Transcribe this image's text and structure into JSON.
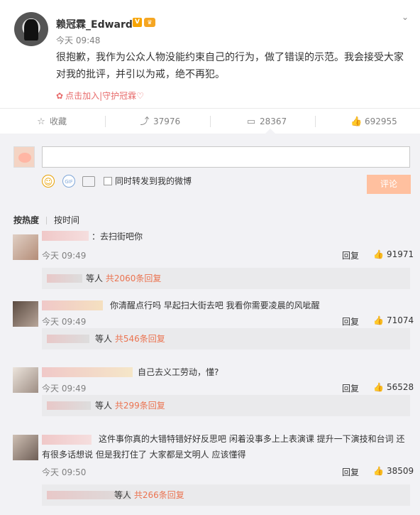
{
  "post": {
    "username": "赖冠霖_Edward",
    "verified_badge": "V",
    "time": "今天 09:48",
    "text": "很抱歉，我作为公众人物没能约束自己的行为，做了错误的示范。我会接受大家对我的批评，并引以为戒，绝不再犯。",
    "guard_link": "点击加入|守护冠霖♡"
  },
  "actions": {
    "favorite_label": "收藏",
    "repost_count": "37976",
    "comment_count": "28367",
    "like_count": "692955"
  },
  "composer": {
    "placeholder": "",
    "forward_label": "同时转发到我的微博",
    "submit_label": "评论",
    "gif_label": "GIF"
  },
  "sort": {
    "hot_label": "按热度",
    "time_label": "按时间"
  },
  "comments": [
    {
      "text": "：去扫街吧你",
      "time": "今天 09:49",
      "reply_label": "回复",
      "likes": "91971",
      "sub_prefix": "等人",
      "sub_link": "共2060条回复",
      "avatar_color": "#c9a58f"
    },
    {
      "text": "你清醒点行吗 早起扫大街去吧 我看你需要凌晨的风呲醒",
      "time": "今天 09:49",
      "reply_label": "回复",
      "likes": "71074",
      "sub_prefix": "等人",
      "sub_link": "共546条回复",
      "avatar_color": "#8a7b70"
    },
    {
      "text": "自己去义工劳动，懂?",
      "time": "今天 09:49",
      "reply_label": "回复",
      "likes": "56528",
      "sub_prefix": "等人",
      "sub_link": "共299条回复",
      "avatar_color": "#b7a79a"
    },
    {
      "text_line1": "这件事你真的大错特错好好反思吧 闲着没事多上上表演课 提升一下演技和台词 还",
      "text_line2": "有很多话想说 但是我打住了 大家都是文明人 应该懂得",
      "time": "今天 09:50",
      "reply_label": "回复",
      "likes": "38509",
      "sub_prefix": "等人",
      "sub_link": "共266条回复",
      "avatar_color": "#a08c80"
    }
  ]
}
